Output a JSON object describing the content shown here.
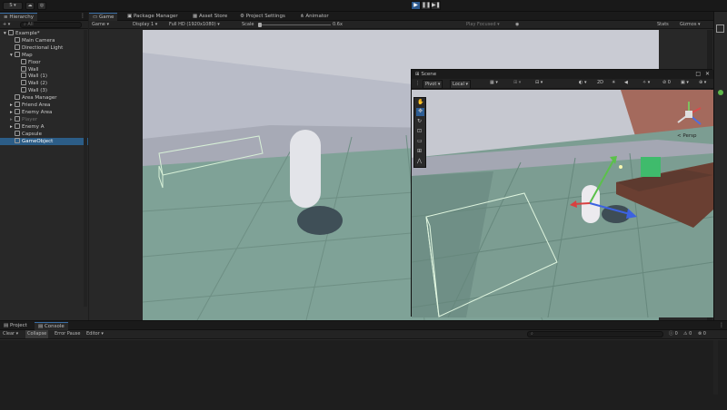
{
  "toolbar": {
    "account_label": "S",
    "play_icon": "play-icon",
    "pause_icon": "pause-icon",
    "step_icon": "step-icon"
  },
  "hierarchy": {
    "tab_label": "Hierarchy",
    "add_label": "+",
    "search_placeholder": "All",
    "items": [
      {
        "label": "Example*",
        "depth": 0
      },
      {
        "label": "Main Camera",
        "depth": 1
      },
      {
        "label": "Directional Light",
        "depth": 1
      },
      {
        "label": "Map",
        "depth": 1
      },
      {
        "label": "Floor",
        "depth": 2
      },
      {
        "label": "Wall",
        "depth": 2
      },
      {
        "label": "Wall (1)",
        "depth": 2
      },
      {
        "label": "Wall (2)",
        "depth": 2
      },
      {
        "label": "Wall (3)",
        "depth": 2
      },
      {
        "label": "Area Manager",
        "depth": 1
      },
      {
        "label": "Friend Area",
        "depth": 1
      },
      {
        "label": "Enemy Area",
        "depth": 1
      },
      {
        "label": "Player",
        "depth": 1
      },
      {
        "label": "Enemy A",
        "depth": 1
      },
      {
        "label": "Capsule",
        "depth": 1
      },
      {
        "label": "GameObject",
        "depth": 1
      }
    ]
  },
  "game_view": {
    "tabs": [
      "Game",
      "Package Manager",
      "Asset Store",
      "Project Settings",
      "Animator"
    ],
    "mode": "Game",
    "display": "Display 1",
    "resolution": "Full HD (1920x1080)",
    "scale_label": "Scale",
    "scale_value": "0.6x",
    "play_focused": "Play Focused",
    "stats": "Stats",
    "gizmos": "Gizmos"
  },
  "scene_view": {
    "tab_label": "Scene",
    "pivot": "Pivot",
    "local": "Local",
    "mode_2d": "2D",
    "persp": "< Persp"
  },
  "bottom": {
    "tabs": [
      "Project",
      "Console"
    ],
    "clear": "Clear",
    "collapse": "Collapse",
    "error_pause": "Error Pause",
    "editor": "Editor",
    "counts": [
      "0",
      "0",
      "0"
    ]
  }
}
